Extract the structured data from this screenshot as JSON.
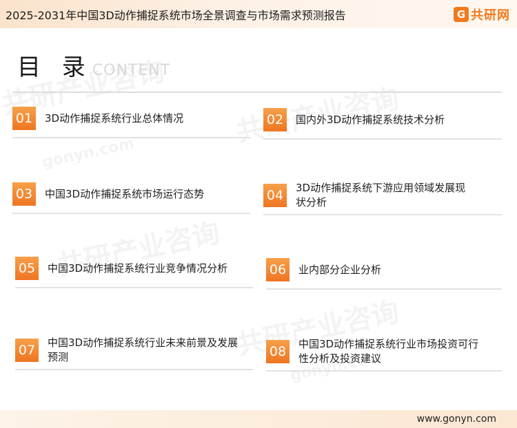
{
  "header": {
    "title": "2025-2031年中国3D动作捕捉系统市场全景调查与市场需求预测报告"
  },
  "logo": {
    "mark": "G",
    "text": "共研网"
  },
  "toc": {
    "title_cn": "目 录",
    "title_en": "CONTENT"
  },
  "items": [
    {
      "num": "01",
      "label": "3D动作捕捉系统行业总体情况"
    },
    {
      "num": "02",
      "label": "国内外3D动作捕捉系统技术分析"
    },
    {
      "num": "03",
      "label": "中国3D动作捕捉系统市场运行态势"
    },
    {
      "num": "04",
      "label": "3D动作捕捉系统下游应用领域发展现状分析"
    },
    {
      "num": "05",
      "label": "中国3D动作捕捉系统行业竞争情况分析"
    },
    {
      "num": "06",
      "label": "业内部分企业分析"
    },
    {
      "num": "07",
      "label": "中国3D动作捕捉系统行业未来前景及发展预测"
    },
    {
      "num": "08",
      "label": "中国3D动作捕捉系统行业市场投资可行性分析及投资建议"
    }
  ],
  "watermark": {
    "brand": "共研产业咨询",
    "domain": "gonyn.com"
  },
  "footer": {
    "url": "www.gonyn.com"
  }
}
